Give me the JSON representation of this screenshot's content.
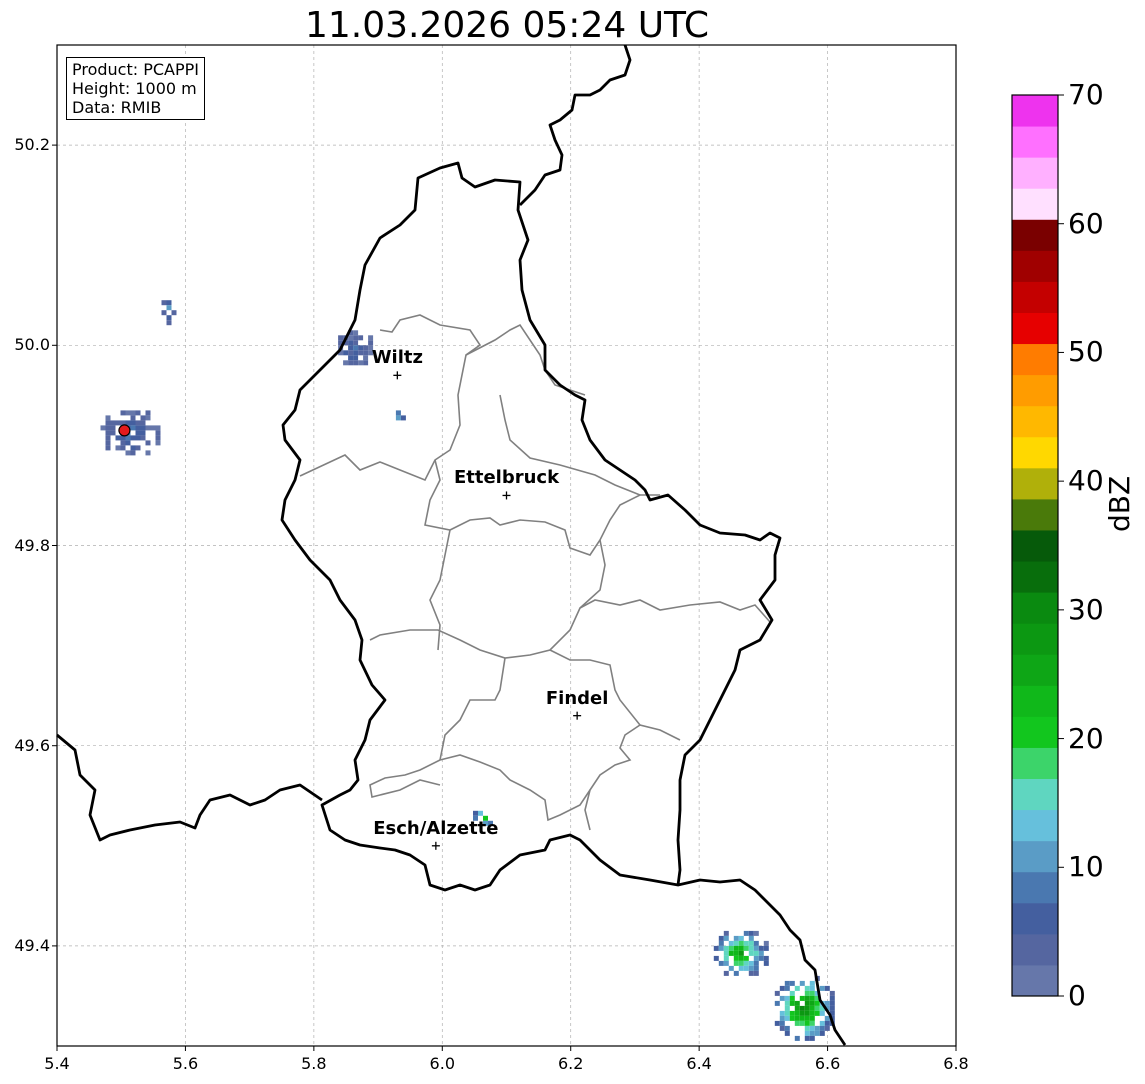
{
  "title": "11.03.2026 05:24 UTC",
  "info_box": {
    "lines": [
      "Product: PCAPPI",
      "Height: 1000 m",
      "Data: RMIB"
    ]
  },
  "axes": {
    "lon_range": [
      5.4,
      6.8
    ],
    "lat_range": [
      49.3,
      50.3
    ],
    "x_ticks": [
      "5.4",
      "5.6",
      "5.8",
      "6.0",
      "6.2",
      "6.4",
      "6.6",
      "6.8"
    ],
    "y_ticks": [
      "50.2",
      "50.0",
      "49.8",
      "49.6",
      "49.4"
    ],
    "x_tick_values": [
      5.4,
      5.6,
      5.8,
      6.0,
      6.2,
      6.4,
      6.6,
      6.8
    ],
    "y_tick_values": [
      50.2,
      50.0,
      49.8,
      49.6,
      49.4
    ],
    "grid": true
  },
  "cities": [
    {
      "name": "Wiltz",
      "lon": 5.93,
      "lat": 49.97
    },
    {
      "name": "Ettelbruck",
      "lon": 6.1,
      "lat": 49.85
    },
    {
      "name": "Findel",
      "lon": 6.21,
      "lat": 49.63
    },
    {
      "name": "Esch/Alzette",
      "lon": 5.99,
      "lat": 49.5
    }
  ],
  "radar_site": {
    "lon": 5.505,
    "lat": 49.915,
    "color": "#e31a1c"
  },
  "colorbar": {
    "label": "dBZ",
    "ticks": [
      "0",
      "10",
      "20",
      "30",
      "40",
      "50",
      "60",
      "70"
    ],
    "tick_values": [
      0,
      10,
      20,
      30,
      40,
      50,
      60,
      70
    ],
    "colors": [
      "#6677aa",
      "#5566a0",
      "#445f9f",
      "#4a78b0",
      "#5a9cc6",
      "#66c0dc",
      "#5fd6c0",
      "#3cd46a",
      "#12c61e",
      "#10b81a",
      "#0ea616",
      "#0c9812",
      "#0a8a10",
      "#086e0c",
      "#065a0a",
      "#4a7a0a",
      "#b0b00a",
      "#ffd800",
      "#ffb800",
      "#ff9c00",
      "#ff7c00",
      "#e60000",
      "#c40000",
      "#a00000",
      "#7a0000",
      "#ffe0ff",
      "#ffb0ff",
      "#ff70ff",
      "#ee33ee"
    ]
  },
  "echoes": [
    {
      "lon": 6.46,
      "lat": 49.395,
      "rx": 0.045,
      "ry": 0.025,
      "dbz": 28
    },
    {
      "lon": 6.56,
      "lat": 49.34,
      "rx": 0.05,
      "ry": 0.035,
      "dbz": 32
    },
    {
      "lon": 6.06,
      "lat": 49.53,
      "rx": 0.02,
      "ry": 0.01,
      "dbz": 22
    },
    {
      "lon": 5.51,
      "lat": 49.915,
      "rx": 0.05,
      "ry": 0.025,
      "dbz": 8
    },
    {
      "lon": 5.86,
      "lat": 50.0,
      "rx": 0.03,
      "ry": 0.02,
      "dbz": 8
    },
    {
      "lon": 5.57,
      "lat": 50.04,
      "rx": 0.015,
      "ry": 0.015,
      "dbz": 10
    },
    {
      "lon": 5.93,
      "lat": 49.93,
      "rx": 0.01,
      "ry": 0.01,
      "dbz": 12
    }
  ]
}
